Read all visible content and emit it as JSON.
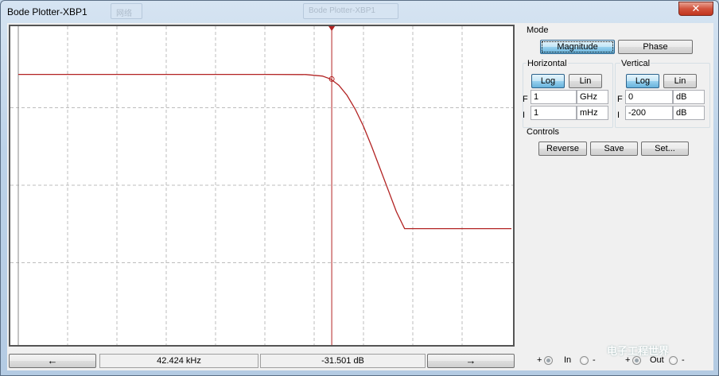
{
  "window": {
    "title": "Bode Plotter-XBP1",
    "close_label": "✕",
    "ghost_labels": [
      "网络",
      "Bode Plotter-XBP1"
    ]
  },
  "mode": {
    "label": "Mode",
    "magnitude_label": "Magnitude",
    "phase_label": "Phase",
    "selected": "Magnitude"
  },
  "horizontal": {
    "label": "Horizontal",
    "log_label": "Log",
    "lin_label": "Lin",
    "scale": "Log",
    "f_label": "F",
    "f_value": "1",
    "f_unit": "GHz",
    "i_label": "I",
    "i_value": "1",
    "i_unit": "mHz"
  },
  "vertical": {
    "label": "Vertical",
    "log_label": "Log",
    "lin_label": "Lin",
    "scale": "Log",
    "f_label": "F",
    "f_value": "0",
    "f_unit": "dB",
    "i_label": "I",
    "i_value": "-200",
    "i_unit": "dB"
  },
  "controls": {
    "label": "Controls",
    "reverse_label": "Reverse",
    "save_label": "Save",
    "set_label": "Set..."
  },
  "readout": {
    "frequency": "42.424 kHz",
    "magnitude": "-31.501 dB",
    "left_arrow": "←",
    "right_arrow": "→"
  },
  "terminals": {
    "in_plus": "+",
    "in_label": "In",
    "in_minus": "-",
    "out_plus": "+",
    "out_label": "Out",
    "out_minus": "-"
  },
  "watermark": "电子工程世界",
  "colors": {
    "trace": "#b22222",
    "grid": "#bdbdbd",
    "cursor": "#b22222"
  },
  "chart_data": {
    "type": "line",
    "xscale": "log",
    "xlim": [
      "1 mHz",
      "1 GHz"
    ],
    "ylim": [
      -200,
      0
    ],
    "grid": true,
    "cursor": {
      "x": "42.424 kHz",
      "y": "-31.501 dB"
    },
    "series": [
      {
        "x_log10_hz": [
          -3,
          1,
          2,
          3,
          4,
          4.4,
          4.6,
          4.8,
          5.0,
          5.2,
          5.4,
          5.6,
          5.8,
          6.0,
          6.2,
          6.4,
          9
        ],
        "y_db": [
          -28.5,
          -28.5,
          -28.5,
          -28.5,
          -28.6,
          -29.6,
          -31.5,
          -35.5,
          -42,
          -51,
          -62,
          -75,
          -89,
          -103,
          -117,
          -128,
          -128
        ]
      }
    ]
  }
}
